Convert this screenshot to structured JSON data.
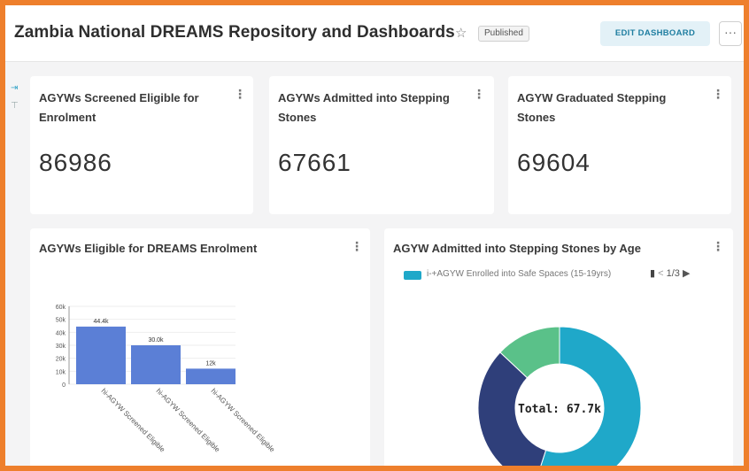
{
  "header": {
    "title": "Zambia National DREAMS Repository and Dashboards",
    "status_badge": "Published",
    "edit_button": "EDIT DASHBOARD",
    "more_button": "···",
    "favorite_icon": "star-icon"
  },
  "kpis": [
    {
      "title": "AGYWs Screened Eligible for Enrolment",
      "value": "86986"
    },
    {
      "title": "AGYWs Admitted into Stepping Stones",
      "value": "67661"
    },
    {
      "title": "AGYW Graduated Stepping Stones",
      "value": "69604"
    }
  ],
  "bar_card": {
    "title": "AGYWs Eligible for DREAMS Enrolment"
  },
  "donut_card": {
    "title": "AGYW Admitted into Stepping Stones by Age",
    "legend_label": "i-+AGYW Enrolled into Safe Spaces (15-19yrs)",
    "legend_page": "1/3",
    "center_label": "Total: 67.7k"
  },
  "chart_data": [
    {
      "type": "bar",
      "title": "AGYWs Eligible for DREAMS Enrolment",
      "categories": [
        "hi-AGYW Screened Eligible",
        "hi-AGYW Screened Eligible",
        "hi-AGYW Screened Eligible"
      ],
      "values": [
        44.4,
        30.0,
        12.0
      ],
      "data_labels": [
        "44.4k",
        "30.0k",
        "12k"
      ],
      "y_ticks": [
        "0",
        "10k",
        "20k",
        "30k",
        "40k",
        "50k",
        "60k"
      ],
      "ylim": [
        0,
        60
      ],
      "grid": true,
      "color": "#5b7fd6"
    },
    {
      "type": "pie",
      "title": "AGYW Admitted into Stepping Stones by Age",
      "total_label": "Total: 67.7k",
      "slices": [
        {
          "name": "i-+AGYW Enrolled into Safe Spaces (15-19yrs)",
          "value": 0.55,
          "color": "#1fa8c9"
        },
        {
          "name": "",
          "value": 0.32,
          "color": "#2f3f7a"
        },
        {
          "name": "",
          "value": 0.13,
          "color": "#5ac189"
        }
      ]
    }
  ]
}
